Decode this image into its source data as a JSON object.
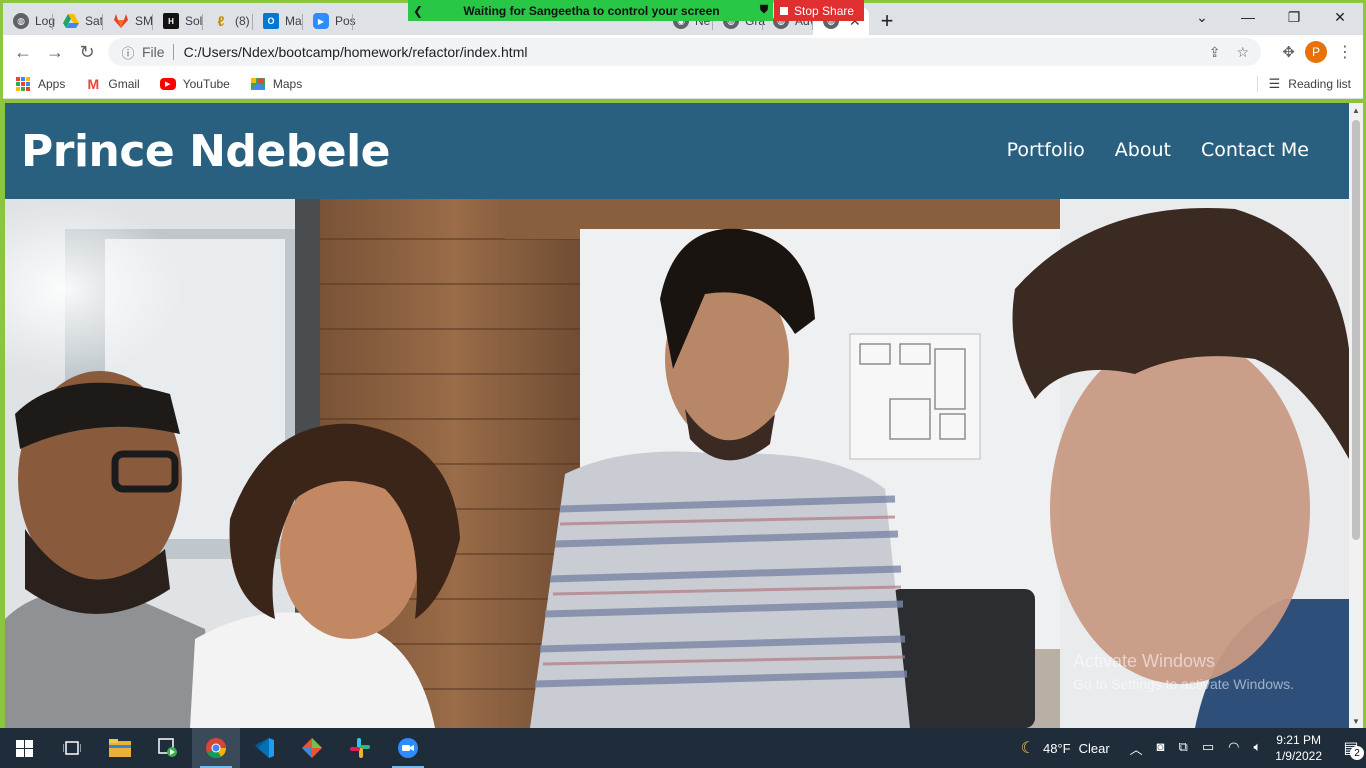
{
  "screen_share": {
    "banner_text": "Waiting for Sangeetha to control your screen",
    "stop_label": "Stop Share"
  },
  "tabs": [
    {
      "label": "Log",
      "icon": "globe-icon",
      "color": "#5f6368"
    },
    {
      "label": "Sat",
      "icon": "google-drive-icon",
      "color": "#1fa463"
    },
    {
      "label": "SM",
      "icon": "gitlab-icon",
      "color": "#e24329"
    },
    {
      "label": "Sol",
      "icon": "hackerrank-icon",
      "color": "#111111"
    },
    {
      "label": "(8)",
      "icon": "notification-icon",
      "color": "#f4b400"
    },
    {
      "label": "Ma",
      "icon": "outlook-icon",
      "color": "#0078d4"
    },
    {
      "label": "Pos",
      "icon": "zoom-icon",
      "color": "#2d8cff"
    },
    {
      "label": "Ne",
      "icon": "chrome-icon",
      "color": "#5f6368"
    },
    {
      "label": "Gra",
      "icon": "globe-icon",
      "color": "#5f6368"
    },
    {
      "label": "Adv",
      "icon": "globe-icon",
      "color": "#5f6368"
    }
  ],
  "active_tab": {
    "icon": "globe-icon",
    "close": "✕"
  },
  "toolbar": {
    "scheme_label": "File",
    "url": "C:/Users/Ndex/bootcamp/homework/refactor/index.html",
    "avatar_letter": "P"
  },
  "bookmarks": {
    "items": [
      {
        "label": "Apps",
        "icon": "apps-grid-icon"
      },
      {
        "label": "Gmail",
        "icon": "gmail-icon"
      },
      {
        "label": "YouTube",
        "icon": "youtube-icon"
      },
      {
        "label": "Maps",
        "icon": "maps-icon"
      }
    ],
    "reading_list": "Reading list"
  },
  "page": {
    "site_title": "Prince Ndebele",
    "nav": [
      "Portfolio",
      "About",
      "Contact Me"
    ],
    "header_color": "#2a607f"
  },
  "watermark": {
    "title": "Activate Windows",
    "subtitle": "Go to Settings to activate Windows."
  },
  "taskbar": {
    "apps": [
      "start-icon",
      "task-view-icon",
      "file-explorer-icon",
      "media-player-icon",
      "chrome-icon",
      "vscode-icon",
      "git-icon",
      "slack-icon",
      "zoom-icon"
    ],
    "weather_temp": "48°F",
    "weather_desc": "Clear",
    "time": "9:21 PM",
    "date": "1/9/2022",
    "notification_count": "2"
  }
}
